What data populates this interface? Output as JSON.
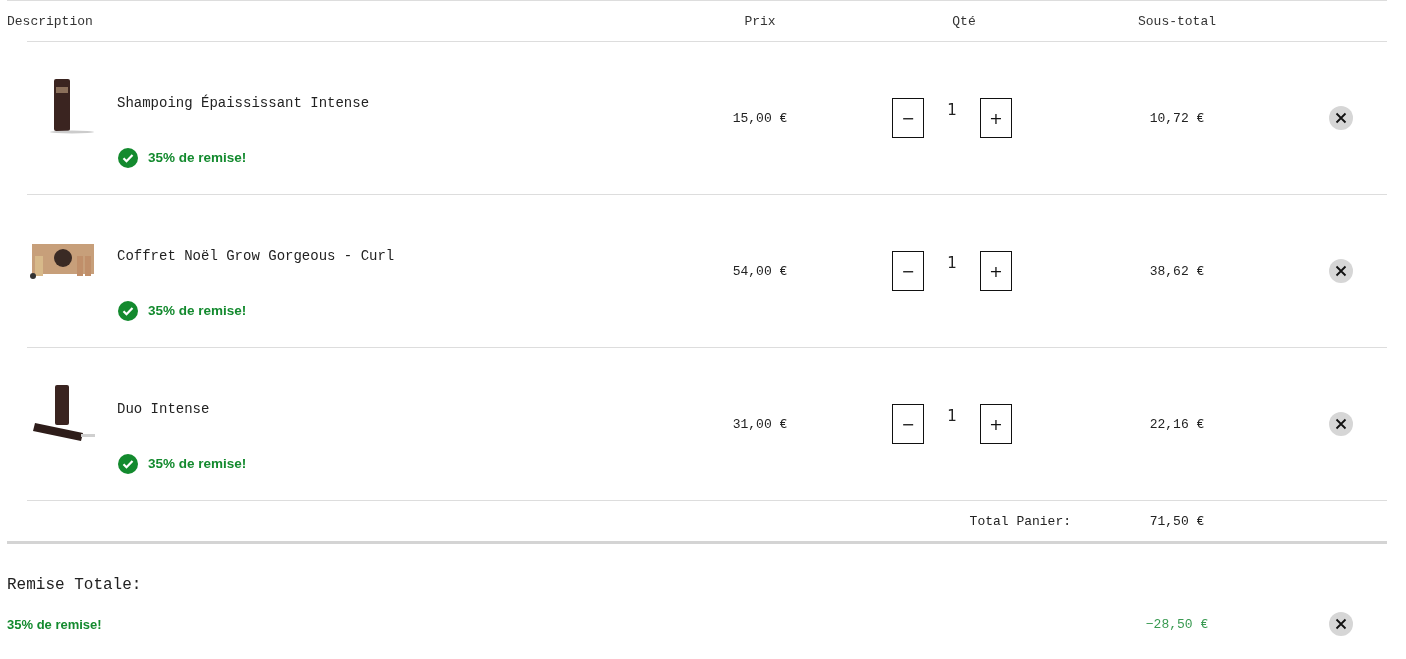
{
  "table": {
    "columns": [
      "Description",
      "Prix",
      "Qté",
      "Sous-total"
    ],
    "rows": [
      {
        "name": "Shampoing Épaississant Intense",
        "discount": "35% de remise!",
        "price": "15,00 €",
        "quantity": "1",
        "minus": "−",
        "plus": "+",
        "subtotal": "10,72 €"
      },
      {
        "name": "Coffret Noël Grow Gorgeous - Curl",
        "discount": "35% de remise!",
        "price": "54,00 €",
        "quantity": "1",
        "minus": "−",
        "plus": "+",
        "subtotal": "38,62 €"
      },
      {
        "name": "Duo Intense",
        "discount": "35% de remise!",
        "price": "31,00 €",
        "quantity": "1",
        "minus": "−",
        "plus": "+",
        "subtotal": "22,16 €"
      }
    ],
    "total_label": "Total Panier:",
    "total": "71,50 €"
  },
  "discount_section": {
    "title": "Remise Totale:",
    "label": "35% de remise!",
    "amount": "−28,50 €"
  }
}
